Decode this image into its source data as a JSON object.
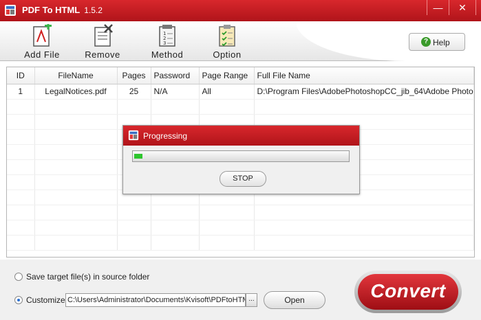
{
  "window": {
    "title": "PDF To HTML",
    "version": "1.5.2",
    "minimize": "—",
    "close": "✕"
  },
  "toolbar": {
    "add_file": "Add File",
    "remove": "Remove",
    "method": "Method",
    "option": "Option",
    "help": "Help"
  },
  "table": {
    "columns": [
      "ID",
      "FileName",
      "Pages",
      "Password",
      "Page Range",
      "Full File Name"
    ],
    "rows": [
      {
        "id": "1",
        "filename": "LegalNotices.pdf",
        "pages": "25",
        "password": "N/A",
        "page_range": "All",
        "full_file_name": "D:\\Program Files\\AdobePhotoshopCC_jib_64\\Adobe Photo..."
      }
    ]
  },
  "progress_dialog": {
    "title": "Progressing",
    "progress_fraction": 0.04,
    "stop_label": "STOP"
  },
  "output": {
    "option_source": "Save target file(s) in source folder",
    "option_customize": "Customize",
    "selected": "customize",
    "path": "C:\\Users\\Administrator\\Documents\\Kvisoft\\PDFtoHTML",
    "browse_label": "...",
    "open_label": "Open",
    "convert_label": "Convert"
  },
  "colors": {
    "titlebar_red": "#c41c22",
    "progress_green": "#2ec52e",
    "help_green": "#3a9a2a"
  }
}
